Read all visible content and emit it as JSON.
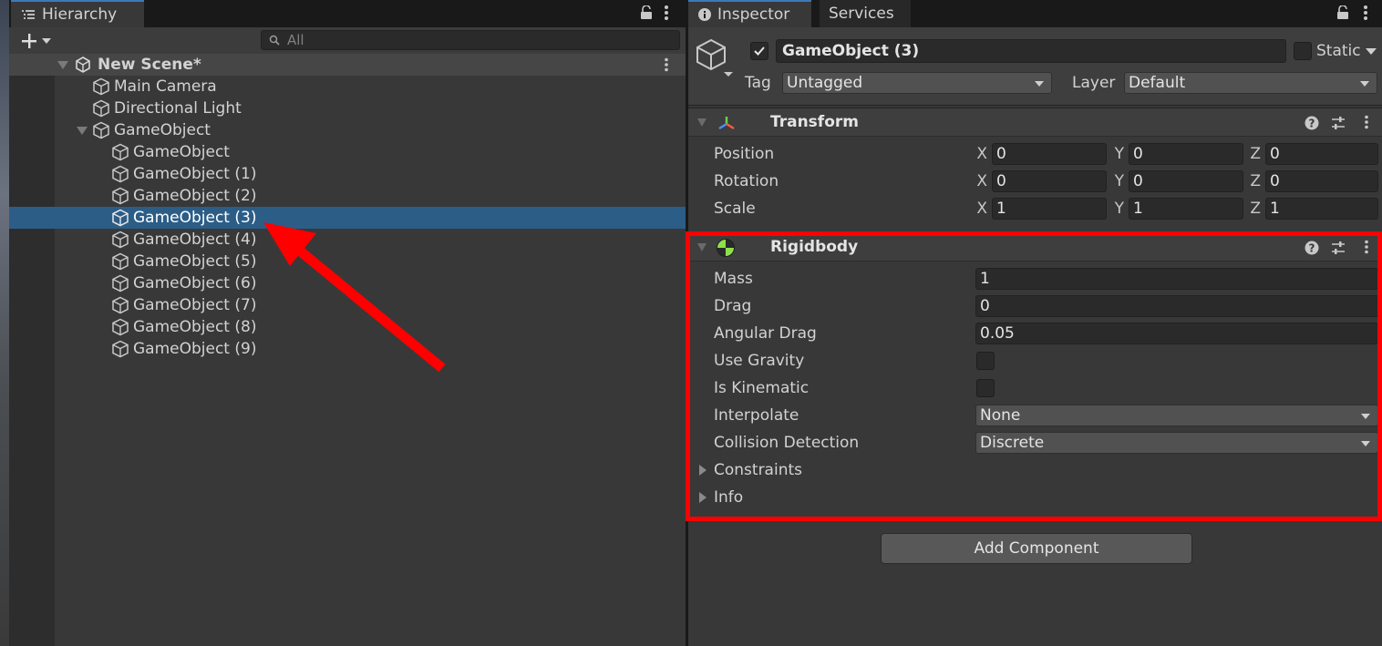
{
  "hierarchy": {
    "tab_label": "Hierarchy",
    "search_placeholder": "All",
    "scene": "New Scene*",
    "items": [
      {
        "label": "Main Camera"
      },
      {
        "label": "Directional Light"
      },
      {
        "label": "GameObject"
      },
      {
        "label": "GameObject"
      },
      {
        "label": "GameObject (1)"
      },
      {
        "label": "GameObject (2)"
      },
      {
        "label": "GameObject (3)"
      },
      {
        "label": "GameObject (4)"
      },
      {
        "label": "GameObject (5)"
      },
      {
        "label": "GameObject (6)"
      },
      {
        "label": "GameObject (7)"
      },
      {
        "label": "GameObject (8)"
      },
      {
        "label": "GameObject (9)"
      }
    ]
  },
  "inspector": {
    "tab_label": "Inspector",
    "services_tab_label": "Services",
    "object_name": "GameObject (3)",
    "static_label": "Static",
    "tag_label": "Tag",
    "tag_value": "Untagged",
    "layer_label": "Layer",
    "layer_value": "Default",
    "transform": {
      "title": "Transform",
      "rows": [
        {
          "label": "Position",
          "x": "0",
          "y": "0",
          "z": "0"
        },
        {
          "label": "Rotation",
          "x": "0",
          "y": "0",
          "z": "0"
        },
        {
          "label": "Scale",
          "x": "1",
          "y": "1",
          "z": "1"
        }
      ],
      "axis_x": "X",
      "axis_y": "Y",
      "axis_z": "Z"
    },
    "rigidbody": {
      "title": "Rigidbody",
      "mass_label": "Mass",
      "mass_value": "1",
      "drag_label": "Drag",
      "drag_value": "0",
      "angular_drag_label": "Angular Drag",
      "angular_drag_value": "0.05",
      "use_gravity_label": "Use Gravity",
      "is_kinematic_label": "Is Kinematic",
      "interpolate_label": "Interpolate",
      "interpolate_value": "None",
      "collision_label": "Collision Detection",
      "collision_value": "Discrete",
      "constraints_label": "Constraints",
      "info_label": "Info"
    },
    "add_component_label": "Add Component"
  },
  "colors": {
    "selection": "#2c5d87",
    "highlight": "#ff0000",
    "accent_tab": "#3a79bb"
  }
}
